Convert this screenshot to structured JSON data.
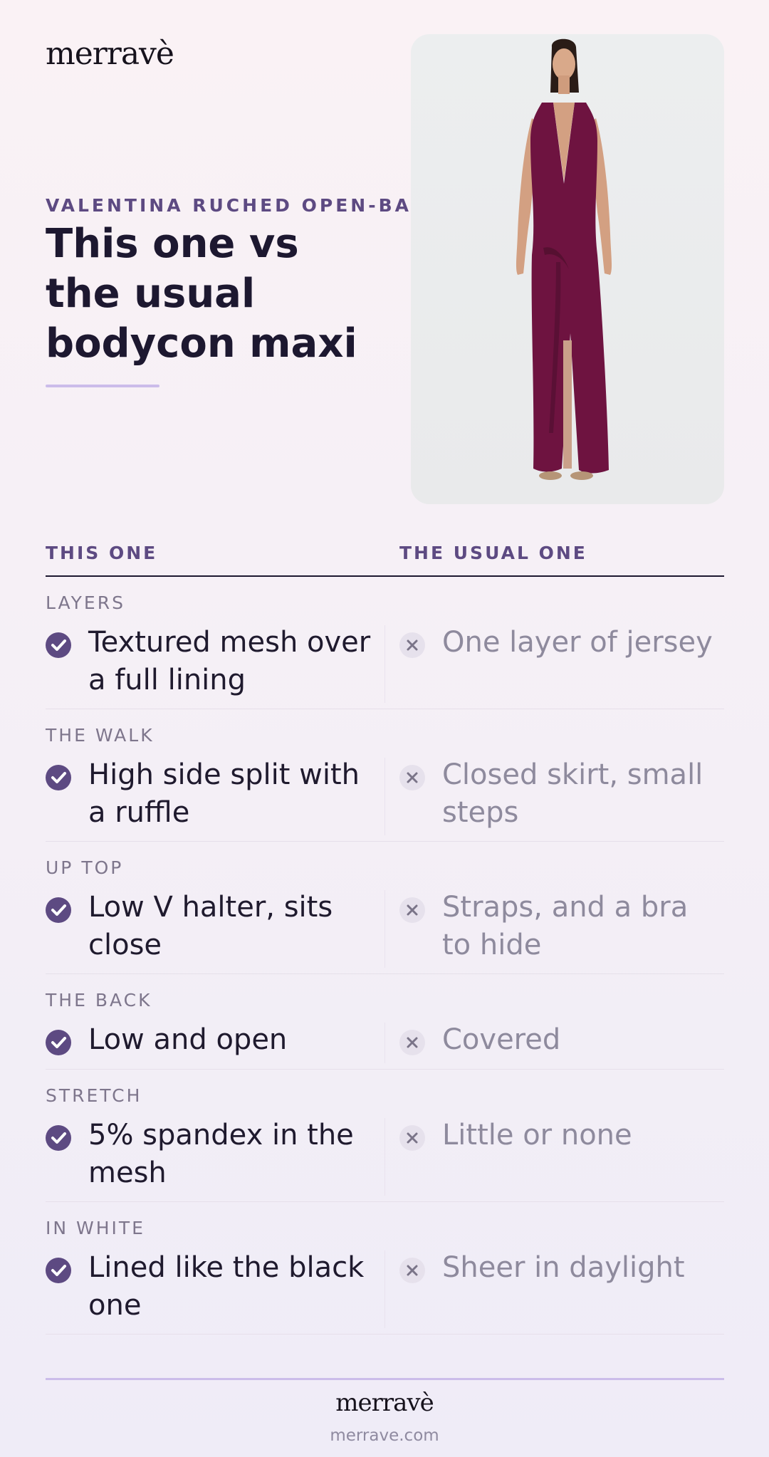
{
  "brand": {
    "logo": "merravè",
    "url": "merrave.com"
  },
  "hero": {
    "eyebrow": "VALENTINA RUCHED OPEN-BACK MAX",
    "title": "This one vs the usual bodycon maxi"
  },
  "table": {
    "col_this": "THIS ONE",
    "col_usual": "THE USUAL ONE",
    "rows": [
      {
        "label": "LAYERS",
        "this": "Textured mesh over a full lining",
        "usual": "One layer of jersey"
      },
      {
        "label": "THE WALK",
        "this": "High side split with a ruffle",
        "usual": "Closed skirt, small steps"
      },
      {
        "label": "UP TOP",
        "this": "Low V halter, sits close",
        "usual": "Straps, and a bra to hide"
      },
      {
        "label": "THE BACK",
        "this": "Low and open",
        "usual": "Covered"
      },
      {
        "label": "STRETCH",
        "this": "5% spandex in the mesh",
        "usual": "Little or none"
      },
      {
        "label": "IN WHITE",
        "this": "Lined like the black one",
        "usual": "Sheer in daylight"
      }
    ]
  },
  "icons": {
    "this": "check-icon",
    "usual": "close-icon"
  },
  "colors": {
    "accent": "#5d4a82",
    "dress": "#6e1340",
    "rule": "#cbbcea"
  }
}
